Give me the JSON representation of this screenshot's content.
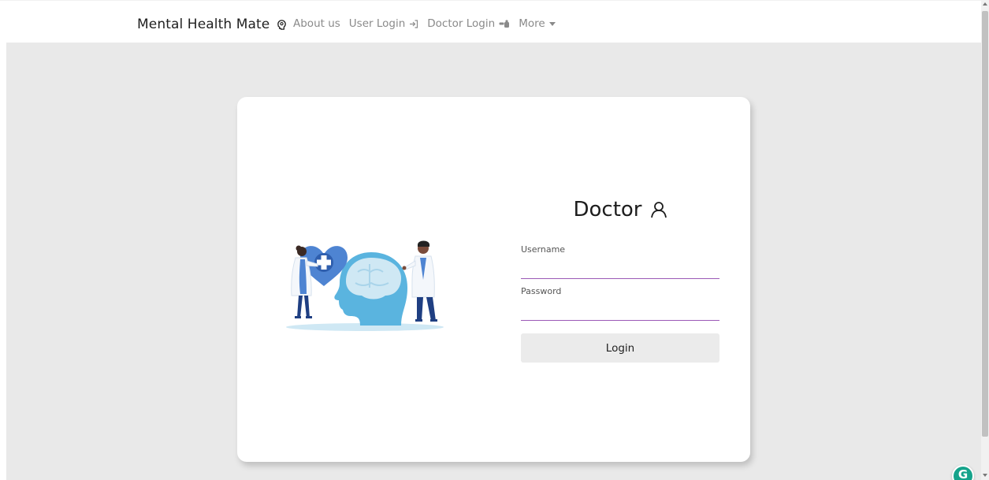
{
  "navbar": {
    "brand": "Mental Health Mate",
    "brand_icon": "brain-head-icon",
    "links": [
      {
        "label": "About us",
        "icon": null
      },
      {
        "label": "User Login",
        "icon": "sign-in-icon"
      },
      {
        "label": "Doctor Login",
        "icon": "doctor-icon"
      },
      {
        "label": "More",
        "icon": "caret-down-icon"
      }
    ]
  },
  "illustration": {
    "icon": "doctors-brain-heart-illustration",
    "colors": {
      "blue": "#4e84d2",
      "light_blue": "#5ab4df",
      "pale_blue": "#cfe8f4"
    }
  },
  "form": {
    "title": "Doctor",
    "title_icon": "user-icon",
    "username_label": "Username",
    "username_value": "",
    "password_label": "Password",
    "password_value": "",
    "login_label": "Login"
  },
  "colors": {
    "page_bg": "#e9e9e9",
    "input_underline": "#9b59b6",
    "button_bg": "#ebebeb",
    "grammarly": "#15a38b"
  },
  "grammarly": {
    "label": "G"
  }
}
